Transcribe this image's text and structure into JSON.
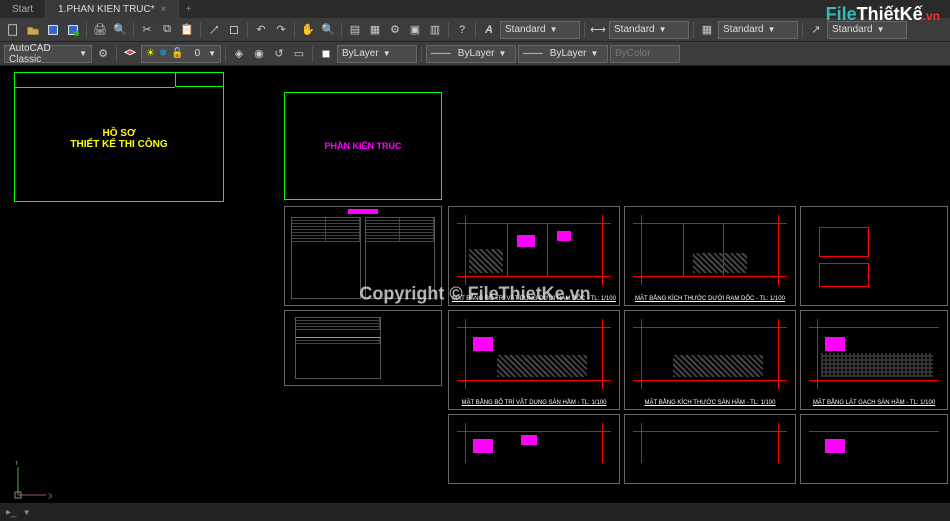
{
  "tabs": {
    "start": "Start",
    "active": "1.PHAN KIEN TRUC*"
  },
  "workspace": {
    "name": "AutoCAD Classic"
  },
  "styles": {
    "s1": "Standard",
    "s2": "Standard",
    "s3": "Standard",
    "s4": "Standard"
  },
  "layers": {
    "l1": "ByLayer",
    "l2": "ByLayer",
    "l3": "ByLayer",
    "l4": "ByColor"
  },
  "coord": "0",
  "sheets": {
    "hoso1": "HỒ SƠ",
    "hoso2": "THIẾT KẾ THI CÔNG",
    "phan": "PHẦN KIẾN TRÚC"
  },
  "drawings": {
    "d1": "MẶT BẰNG BỐ TRÍ VẬT DỤNG DƯỚI RAM DỐC - TL: 1/100",
    "d2": "MẶT BẰNG KÍCH THƯỚC DƯỚI RAM DỐC - TL: 1/100",
    "d3": "MẶT BẰNG BỐ TRÍ VẬT DỤNG SÀN HẦM - TL: 1/100",
    "d4": "MẶT BẰNG KÍCH THƯỚC SÀN HẦM - TL: 1/100",
    "d5": "MẶT BẰNG LÁT GẠCH SÀN HẦM - TL: 1/100"
  },
  "watermark": "Copyright © FileThietKe.vn",
  "logo": {
    "file": "File",
    "tk": "ThiếtKế",
    "vn": ".vn"
  },
  "ucs": {
    "x": "X",
    "y": "Y"
  }
}
